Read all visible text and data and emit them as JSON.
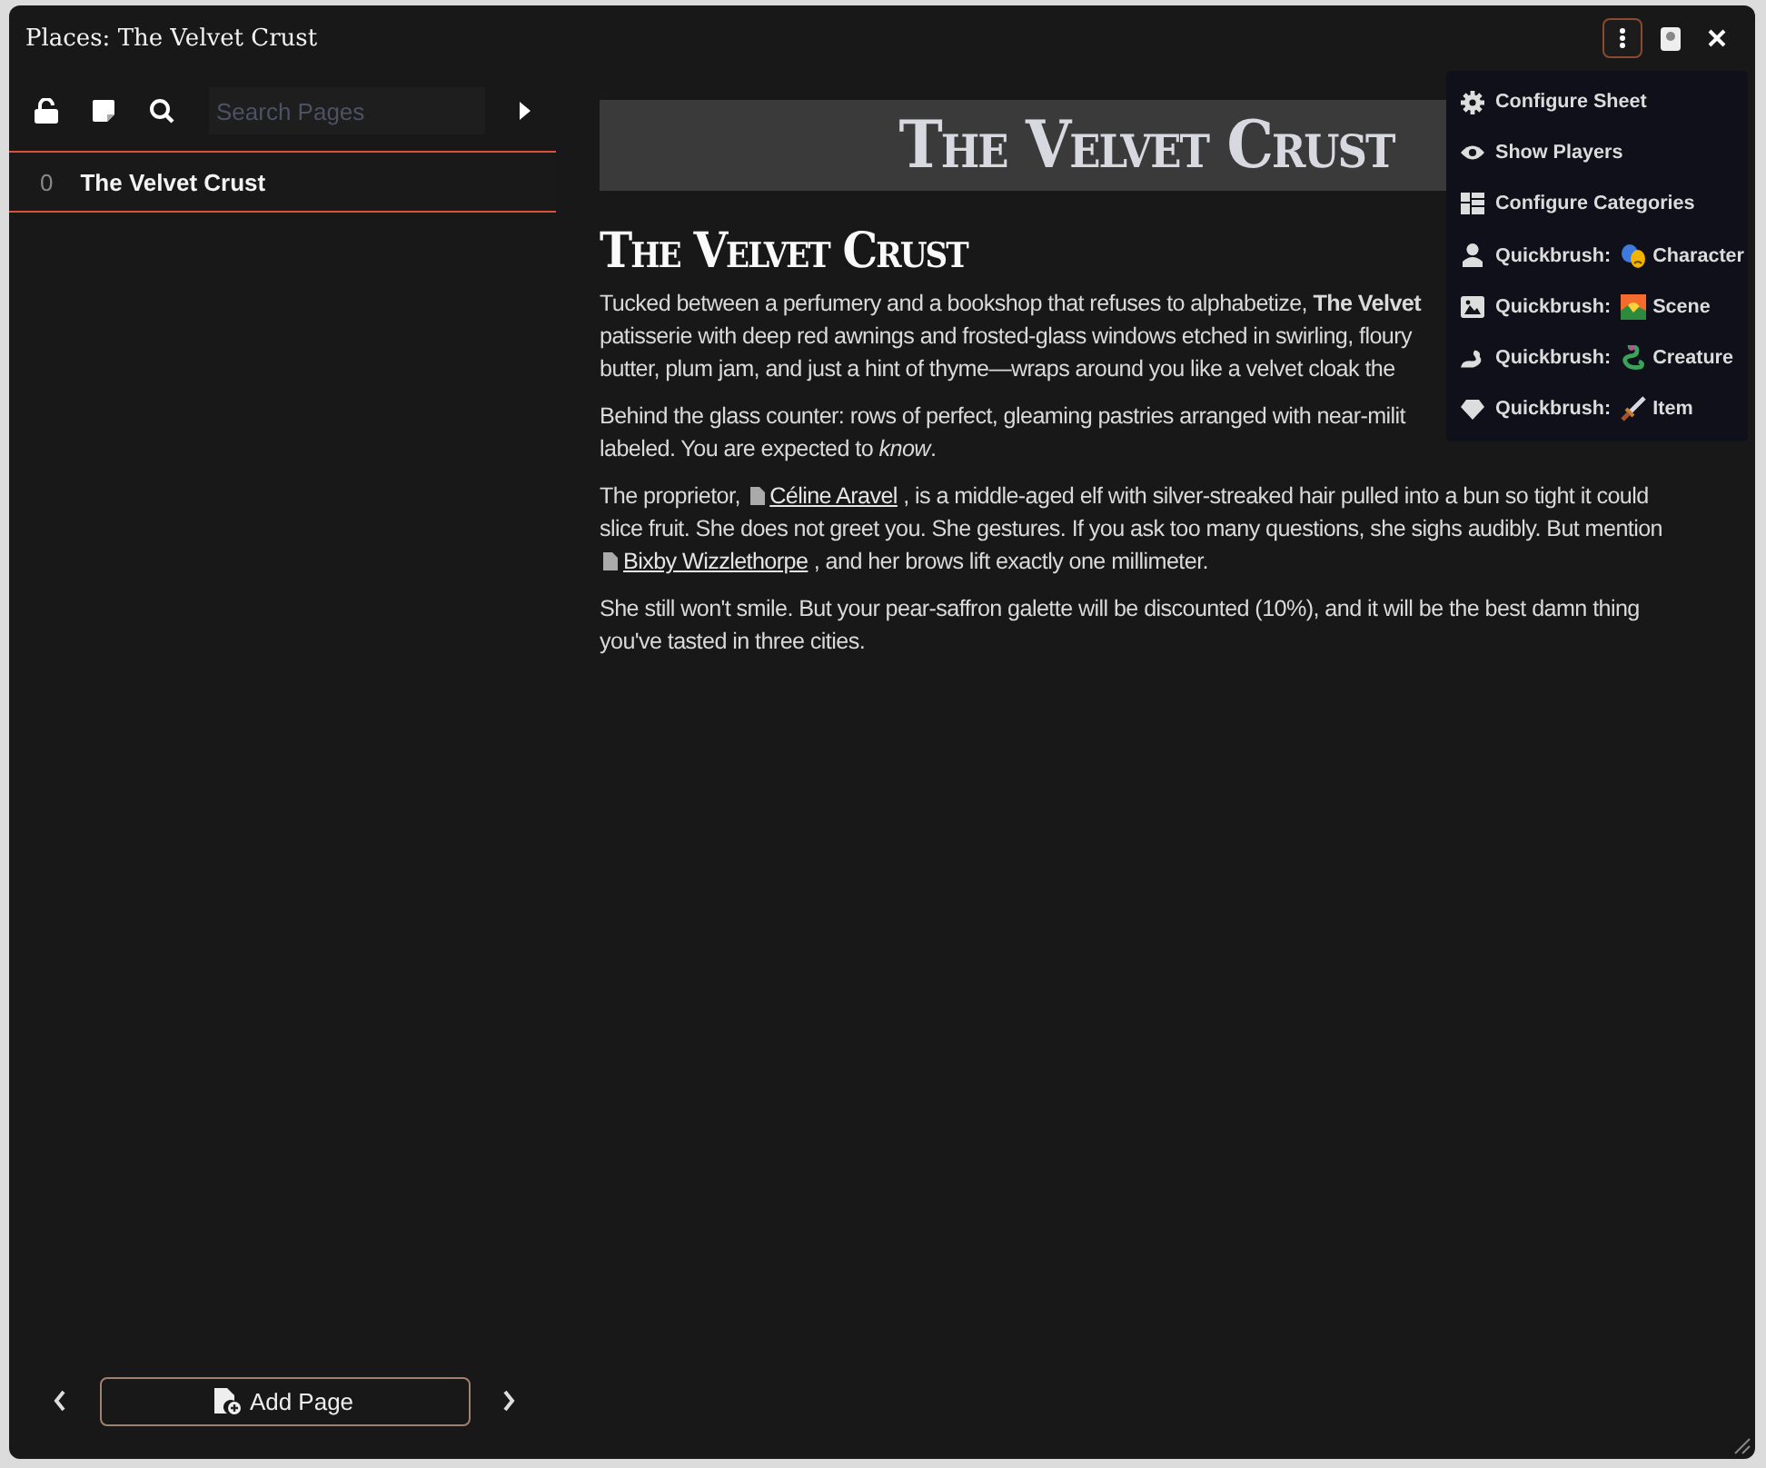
{
  "window": {
    "title": "Places: The Velvet Crust"
  },
  "menu": {
    "open": true,
    "items": [
      {
        "label": "Configure Sheet"
      },
      {
        "label": "Show Players"
      },
      {
        "label": "Configure Categories"
      },
      {
        "label": "Quickbrush:",
        "target": "Character"
      },
      {
        "label": "Quickbrush:",
        "target": "Scene"
      },
      {
        "label": "Quickbrush:",
        "target": "Creature"
      },
      {
        "label": "Quickbrush:",
        "target": "Item"
      }
    ]
  },
  "sidebar": {
    "search": {
      "placeholder": "Search Pages"
    },
    "pages": [
      {
        "number": "0",
        "title": "The Velvet Crust",
        "selected": true
      }
    ],
    "add_button": "Add Page"
  },
  "content": {
    "banner": "The Velvet Crust",
    "heading": "The Velvet Crust",
    "paragraphs": [
      {
        "kind": "lines",
        "lines": [
          "Tucked between a perfumery and a bookshop that refuses to alphabetize, **The Velvet**",
          "patisserie with deep red awnings and frosted-glass windows etched in swirling, floury",
          "butter, plum jam, and just a hint of thyme—wraps around you like a velvet cloak the"
        ]
      },
      {
        "kind": "lines",
        "lines": [
          "Behind the glass counter: rows of perfect, gleaming pastries arranged with near-milit",
          "labeled. You are expected to *know*."
        ]
      },
      {
        "kind": "parts",
        "parts": [
          {
            "kind": "text",
            "text": "The proprietor, "
          },
          {
            "kind": "link",
            "text": "Céline Aravel"
          },
          {
            "kind": "text",
            "text": " , is a middle-aged elf with silver-streaked hair pulled into a bun so tight it could slice fruit. She does not greet you. She gestures. If you ask too many questions, she sighs audibly. But mention "
          },
          {
            "kind": "link",
            "text": "Bixby Wizzlethorpe"
          },
          {
            "kind": "text",
            "text": " , and her brows lift exactly one millimeter."
          }
        ]
      },
      {
        "kind": "parts",
        "parts": [
          {
            "kind": "text",
            "text": "She still won't smile. But your pear-saffron galette will be discounted (10%), and it will be the best damn thing you've tasted in three cities."
          }
        ]
      }
    ]
  }
}
